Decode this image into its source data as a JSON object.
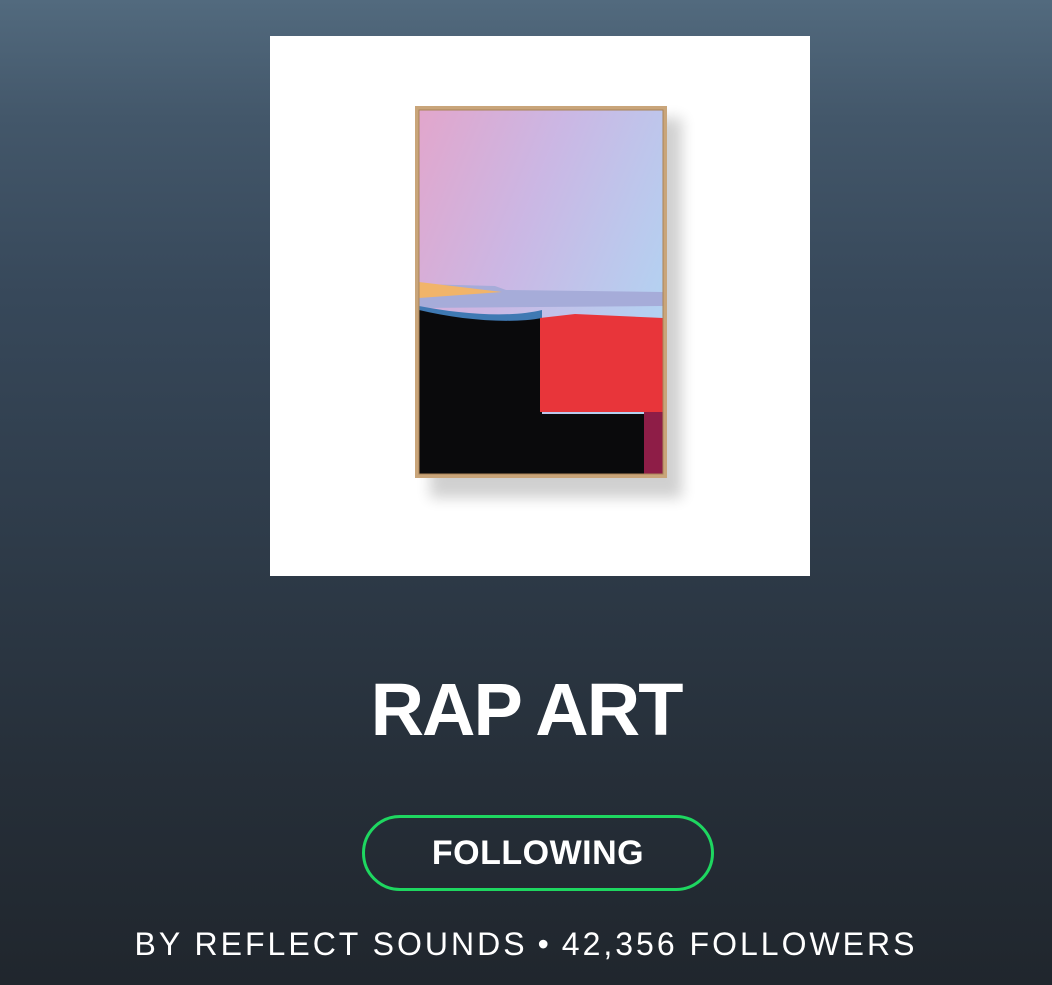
{
  "playlist": {
    "title": "RAP ART",
    "follow_button_label": "FOLLOWING",
    "owner": "BY REFLECT SOUNDS",
    "separator": "•",
    "followers": "42,356 FOLLOWERS"
  },
  "colors": {
    "accent_green": "#1ed760",
    "background_top": "#526a7e",
    "background_bottom": "#20262d",
    "text": "#ffffff"
  }
}
